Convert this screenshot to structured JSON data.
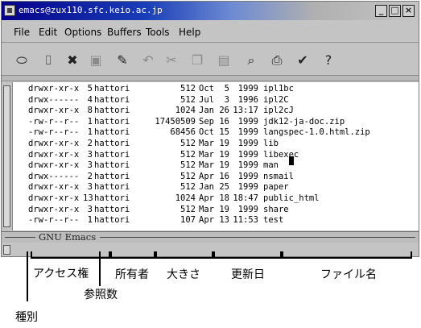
{
  "window": {
    "title": "emacs@zux110.sfc.keio.ac.jp",
    "buttons": [
      "_",
      "□",
      "×"
    ]
  },
  "menubar": [
    "File",
    "Edit",
    "Options",
    "Buffers",
    "Tools",
    "Help"
  ],
  "toolbar_icons": [
    {
      "name": "open-file-icon",
      "glyph": "⬭",
      "enabled": true
    },
    {
      "name": "open-directory-icon",
      "glyph": "⌷",
      "enabled": true
    },
    {
      "name": "close-icon",
      "glyph": "✖",
      "enabled": true
    },
    {
      "name": "save-icon",
      "glyph": "▣",
      "enabled": false
    },
    {
      "name": "save-as-icon",
      "glyph": "✎",
      "enabled": true
    },
    {
      "name": "undo-icon",
      "glyph": "↶",
      "enabled": false
    },
    {
      "name": "cut-icon",
      "glyph": "✂",
      "enabled": false
    },
    {
      "name": "copy-icon",
      "glyph": "❐",
      "enabled": false
    },
    {
      "name": "paste-icon",
      "glyph": "▤",
      "enabled": false
    },
    {
      "name": "search-icon",
      "glyph": "⌕",
      "enabled": true
    },
    {
      "name": "print-icon",
      "glyph": "⎙",
      "enabled": true
    },
    {
      "name": "preferences-icon",
      "glyph": "✔",
      "enabled": true
    },
    {
      "name": "help-icon",
      "glyph": "?",
      "enabled": true
    }
  ],
  "listing": [
    {
      "perm": "drwxr-xr-x",
      "links": "5",
      "owner": "hattori",
      "size": "512",
      "month": "Oct",
      "day": "5",
      "time": "1999",
      "name": "ipl1bc"
    },
    {
      "perm": "drwx------",
      "links": "4",
      "owner": "hattori",
      "size": "512",
      "month": "Jul",
      "day": "3",
      "time": "1996",
      "name": "ipl2C"
    },
    {
      "perm": "drwxr-xr-x",
      "links": "8",
      "owner": "hattori",
      "size": "1024",
      "month": "Jan",
      "day": "26",
      "time": "13:17",
      "name": "ipl2cJ"
    },
    {
      "perm": "-rw-r--r--",
      "links": "1",
      "owner": "hattori",
      "size": "17450509",
      "month": "Sep",
      "day": "16",
      "time": "1999",
      "name": "jdk12-ja-doc.zip"
    },
    {
      "perm": "-rw-r--r--",
      "links": "1",
      "owner": "hattori",
      "size": "68456",
      "month": "Oct",
      "day": "15",
      "time": "1999",
      "name": "langspec-1.0.html.zip"
    },
    {
      "perm": "drwxr-xr-x",
      "links": "2",
      "owner": "hattori",
      "size": "512",
      "month": "Mar",
      "day": "19",
      "time": "1999",
      "name": "lib"
    },
    {
      "perm": "drwxr-xr-x",
      "links": "3",
      "owner": "hattori",
      "size": "512",
      "month": "Mar",
      "day": "19",
      "time": "1999",
      "name": "libexec"
    },
    {
      "perm": "drwxr-xr-x",
      "links": "3",
      "owner": "hattori",
      "size": "512",
      "month": "Mar",
      "day": "19",
      "time": "1999",
      "name": "man"
    },
    {
      "perm": "drwx------",
      "links": "2",
      "owner": "hattori",
      "size": "512",
      "month": "Apr",
      "day": "16",
      "time": "1999",
      "name": "nsmail"
    },
    {
      "perm": "drwxr-xr-x",
      "links": "3",
      "owner": "hattori",
      "size": "512",
      "month": "Jan",
      "day": "25",
      "time": "1999",
      "name": "paper"
    },
    {
      "perm": "drwxr-xr-x",
      "links": "13",
      "owner": "hattori",
      "size": "1024",
      "month": "Apr",
      "day": "18",
      "time": "18:47",
      "name": "public_html"
    },
    {
      "perm": "drwxr-xr-x",
      "links": "3",
      "owner": "hattori",
      "size": "512",
      "month": "Mar",
      "day": "19",
      "time": "1999",
      "name": "share"
    },
    {
      "perm": "-rw-r--r--",
      "links": "1",
      "owner": "hattori",
      "size": "107",
      "month": "Apr",
      "day": "13",
      "time": "11:53",
      "name": "test"
    }
  ],
  "modeline": "GNU Emacs",
  "labels": {
    "access_rights": "アクセス権",
    "owner": "所有者",
    "size": "大きさ",
    "updated": "更新日",
    "filename": "ファイル名",
    "type": "種別",
    "ref_count": "参照数"
  }
}
